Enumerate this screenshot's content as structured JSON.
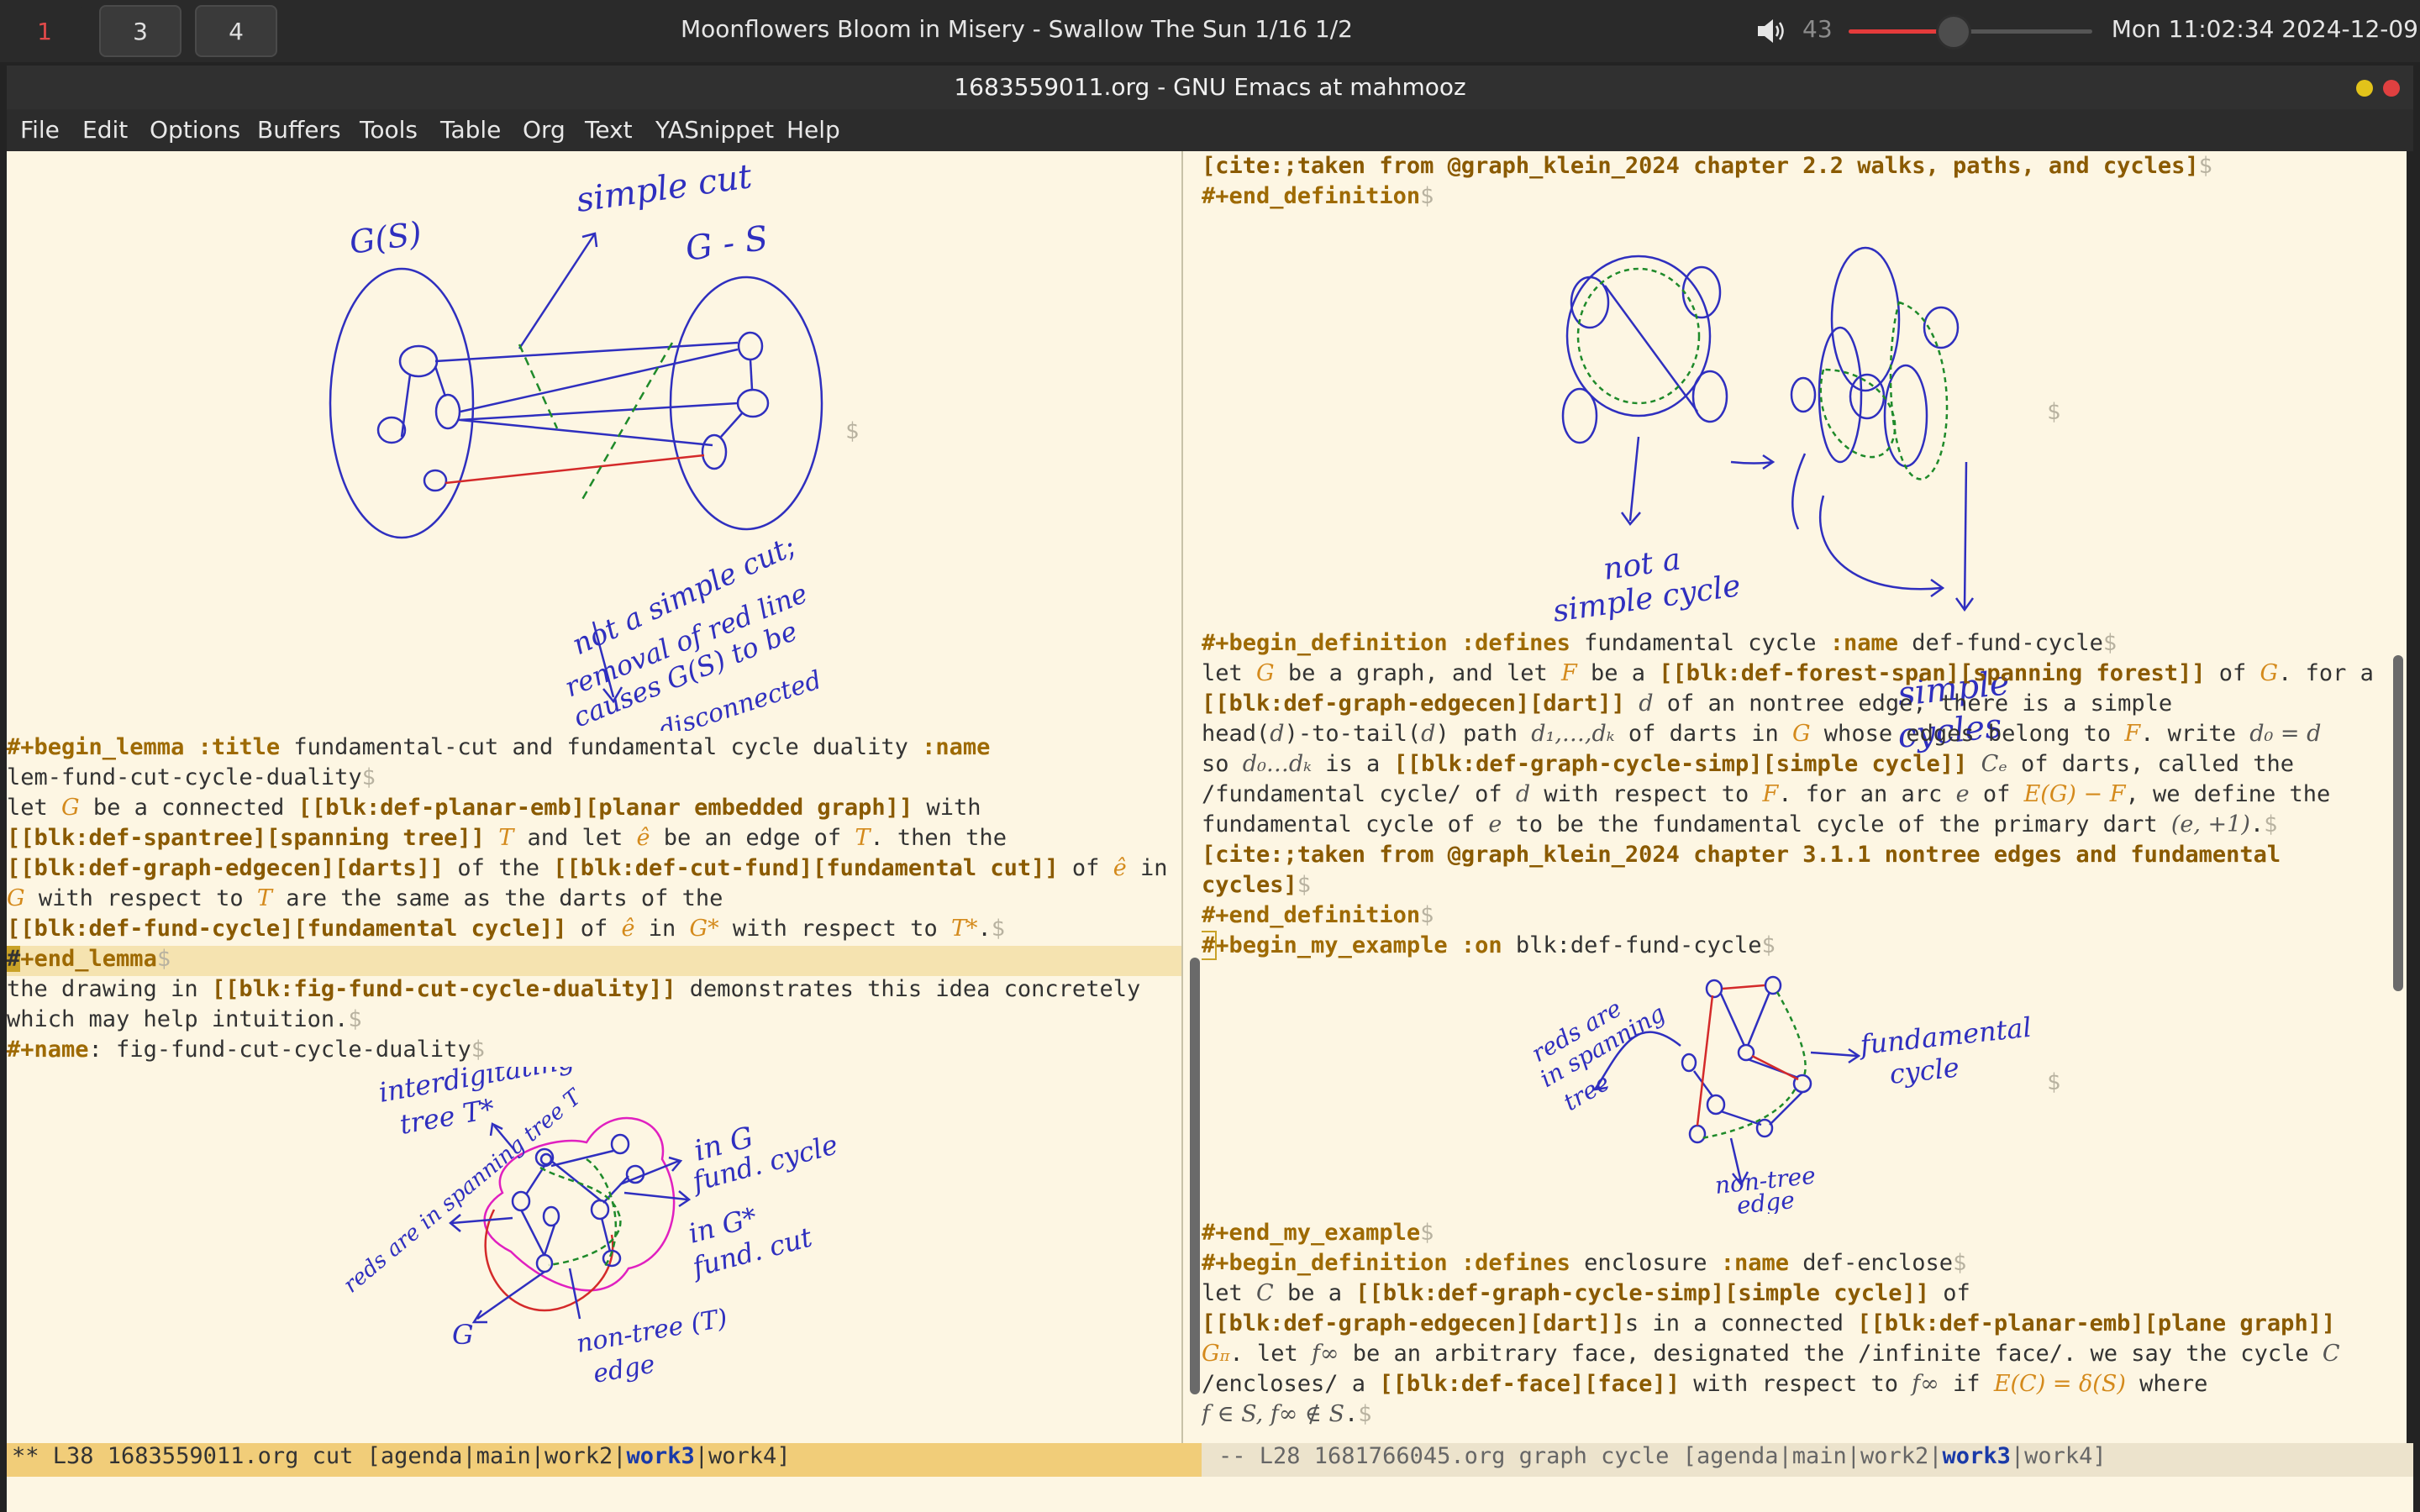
{
  "topbar": {
    "workspaces": [
      "1",
      "3",
      "4"
    ],
    "now_playing": "Moonflowers Bloom in Misery - Swallow The Sun 1/16 1/2",
    "volume": 43,
    "volume_label": "43",
    "clock": "Mon 11:02:34 2024-12-09"
  },
  "window": {
    "title": "1683559011.org - GNU Emacs at mahmooz"
  },
  "menubar": [
    "File",
    "Edit",
    "Options",
    "Buffers",
    "Tools",
    "Table",
    "Org",
    "Text",
    "YASnippet",
    "Help"
  ],
  "left_pane": {
    "sketch1": {
      "labels": [
        "G(S)",
        "simple cut",
        "G - S",
        "not a simple cut;",
        "removal of red line",
        "causes G(S) to be",
        "disconnected"
      ]
    },
    "lines": {
      "l1a": "#+begin_lemma :title",
      "l1b": " fundamental-cut and fundamental cycle duality ",
      "l1c": ":name",
      "l2": "lem-fund-cut-cycle-duality",
      "l3a": "let ",
      "l3b": "G",
      "l3c": " be a connected ",
      "l3d": "[[blk:def-planar-emb][planar embedded graph]]",
      "l3e": " with",
      "l4a": "[[blk:def-spantree][spanning tree]]",
      "l4b": " ",
      "l4c": "T",
      "l4d": " and let ",
      "l4e": "ê",
      "l4f": " be an edge of ",
      "l4g": "T",
      "l4h": ". then the",
      "l5a": "[[blk:def-graph-edgecen][darts]]",
      "l5b": " of the ",
      "l5c": "[[blk:def-cut-fund][fundamental cut]]",
      "l5d": " of ",
      "l5e": "ê",
      "l5f": " in",
      "l6a": "G",
      "l6b": " with respect to ",
      "l6c": "T",
      "l6d": " are the same as the darts of the",
      "l7a": "[[blk:def-fund-cycle][fundamental cycle]]",
      "l7b": " of ",
      "l7c": "ê",
      "l7d": " in ",
      "l7e": "G*",
      "l7f": " with respect to ",
      "l7g": "T*",
      "l7h": ".",
      "l8a": "#",
      "l8b": "+end_lemma",
      "l9a": "the drawing in ",
      "l9b": "[[blk:fig-fund-cut-cycle-duality]]",
      "l9c": " demonstrates this idea concretely",
      "l10": "which may help intuition.",
      "l11a": "#+name",
      "l11b": ": fig-fund-cut-cycle-duality"
    },
    "sketch2": {
      "labels": [
        "interdigitating",
        "tree T*",
        "in G",
        "fund. cycle",
        "in G*",
        "fund. cut",
        "reds are in spanning tree T",
        "G",
        "non-tree (T)",
        "edge"
      ]
    }
  },
  "right_pane": {
    "lines": {
      "r1": "[cite:;taken from @graph_klein_2024 chapter 2.2 walks, paths, and cycles]",
      "r2": "#+end_definition",
      "r3a": "#+begin_definition :defines",
      "r3b": " fundamental cycle ",
      "r3c": ":name",
      "r3d": " def-fund-cycle",
      "r4a": "let ",
      "r4b": "G",
      "r4c": " be a graph, and let ",
      "r4d": "F",
      "r4e": " be a ",
      "r4f": "[[blk:def-forest-span][spanning forest]]",
      "r4g": " of ",
      "r4h": "G",
      "r4i": ". for a",
      "r5a": "[[blk:def-graph-edgecen][dart]]",
      "r5b": " ",
      "r5c": "d",
      "r5d": " of an nontree edge, there is a simple",
      "r6a": "head(",
      "r6b": "d",
      "r6c": ")-to-tail(",
      "r6d": "d",
      "r6e": ") path ",
      "r6f": "d₁,…,dₖ",
      "r6g": " of darts in ",
      "r6h": "G",
      "r6i": " whose edges belong to ",
      "r6j": "F",
      "r6k": ". write ",
      "r6l": "d₀ = d",
      "r7a": "so ",
      "r7b": "d₀…dₖ",
      "r7c": " is a ",
      "r7d": "[[blk:def-graph-cycle-simp][simple cycle]]",
      "r7e": " ",
      "r7f": "Cₑ",
      "r7g": " of darts, called the",
      "r8a": "/fundamental cycle/ of ",
      "r8b": "d",
      "r8c": " with respect to ",
      "r8d": "F",
      "r8e": ". for an arc ",
      "r8f": "e",
      "r8g": " of ",
      "r8h": "E(G) − F",
      "r8i": ", we define the",
      "r9a": "fundamental cycle of ",
      "r9b": "e",
      "r9c": " to be the fundamental cycle of the primary dart ",
      "r9d": "(e, +1)",
      "r9e": ".",
      "r10": "[cite:;taken from @graph_klein_2024 chapter 3.1.1 nontree edges and fundamental",
      "r11": "cycles]",
      "r12": "#+end_definition",
      "r13a": "#",
      "r13b": "+begin_my_example :on",
      "r13c": " blk:def-fund-cycle",
      "r14": "#+end_my_example",
      "r15a": "#+begin_definition :defines",
      "r15b": " enclosure ",
      "r15c": ":name",
      "r15d": " def-enclose",
      "r16a": "let ",
      "r16b": "C",
      "r16c": " be a ",
      "r16d": "[[blk:def-graph-cycle-simp][simple cycle]]",
      "r16e": " of",
      "r17a": "[[blk:def-graph-edgecen][dart]]",
      "r17b": "s in a connected ",
      "r17c": "[[blk:def-planar-emb][plane graph]]",
      "r18a": "G",
      "r18b": "π",
      "r18c": ". let ",
      "r18d": "f∞",
      "r18e": " be an arbitrary face, designated the /infinite face/. we say the cycle ",
      "r18f": "C",
      "r19a": "/encloses/ a ",
      "r19b": "[[blk:def-face][face]]",
      "r19c": " with respect to ",
      "r19d": "f∞",
      "r19e": " if ",
      "r19f": "E(C) = δ(S)",
      "r19g": " where",
      "r20a": "f ∈ S, f∞ ∉ S",
      "r20b": "."
    },
    "sketch1": {
      "labels": [
        "not a",
        "simple cycle",
        "simple",
        "cycles"
      ]
    },
    "sketch2": {
      "labels": [
        "reds are",
        "in spanning",
        "tree",
        "fundamental",
        "cycle",
        "non-tree",
        "edge"
      ]
    }
  },
  "modeline_left": {
    "pre": "** L38 1683559011.org cut [agenda|main|work2|",
    "current": "work3",
    "post": "|work4]"
  },
  "modeline_right": {
    "pre": "-- L28 1681766045.org graph cycle [agenda|main|work2|",
    "current": "work3",
    "post": "|work4]"
  }
}
